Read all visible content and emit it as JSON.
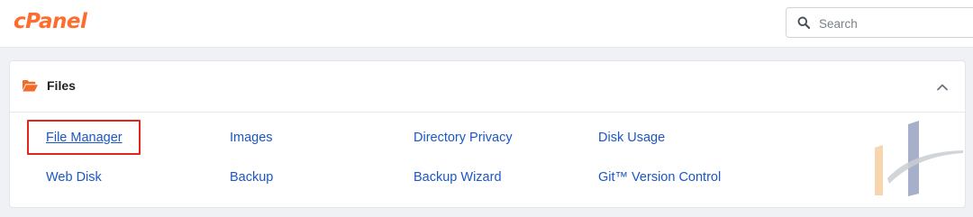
{
  "colors": {
    "brand": "#ff6c2c",
    "link": "#1b57c4",
    "highlight_box": "#e3241b",
    "folder_icon": "#f26b2a",
    "background": "#eff1f4"
  },
  "header": {
    "logo_text": "cPanel",
    "search": {
      "placeholder": "Search",
      "value": "",
      "icon": "search-icon"
    }
  },
  "section": {
    "title": "Files",
    "icon": "folder-open-icon",
    "collapse_icon": "chevron-up-icon",
    "links": [
      {
        "label": "File Manager",
        "highlighted": true,
        "underlined": true
      },
      {
        "label": "Images"
      },
      {
        "label": "Directory Privacy"
      },
      {
        "label": "Disk Usage"
      },
      {
        "label": "Web Disk"
      },
      {
        "label": "Backup"
      },
      {
        "label": "Backup Wizard"
      },
      {
        "label": "Git™ Version Control"
      }
    ]
  },
  "watermark": {
    "icon": "h-logo-watermark-icon"
  }
}
